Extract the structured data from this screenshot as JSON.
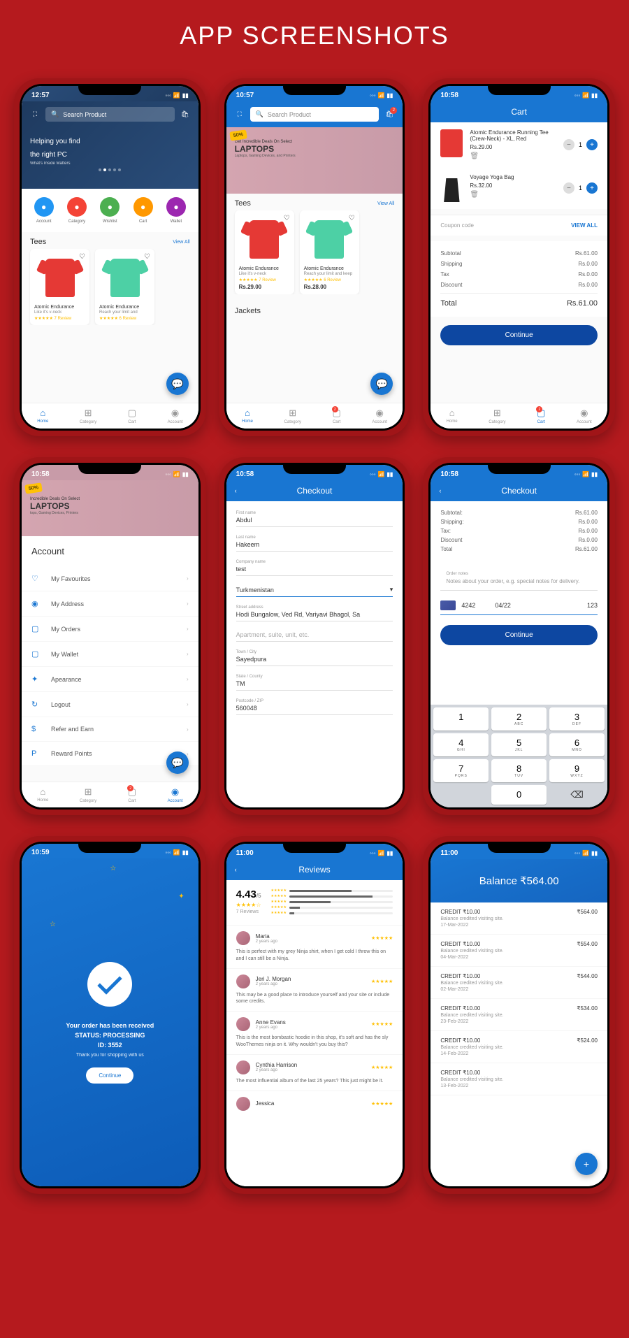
{
  "title": "APP SCREENSHOTS",
  "s1": {
    "time": "12:57",
    "search": "Search Product",
    "banner1": "Helping you find",
    "banner2": "the right PC",
    "banner3": "What's Inside Matters",
    "quick": [
      {
        "l": "Account",
        "c": "#2196f3"
      },
      {
        "l": "Category",
        "c": "#f44336"
      },
      {
        "l": "Wishlist",
        "c": "#4caf50"
      },
      {
        "l": "Cart",
        "c": "#ff9800"
      },
      {
        "l": "Wallet",
        "c": "#9c27b0"
      }
    ],
    "sect": "Tees",
    "viewall": "View All",
    "p": [
      {
        "n": "Atomic Endurance",
        "s": "Like it's v-neck",
        "r": "★★★★★ 7 Review"
      },
      {
        "n": "Atomic Endurance",
        "s": "Reach your limit and",
        "r": "★★★★★ 6 Review"
      }
    ]
  },
  "s2": {
    "time": "10:57",
    "search": "Search Product",
    "badge": "2",
    "bannerBadge": "50%",
    "bb1": "Get Incredible Deals On Select",
    "bb2": "LAPTOPS",
    "bb3": "Laptops, Gaming Devices, and Printers",
    "sect": "Tees",
    "viewall": "View All",
    "sect2": "Jackets",
    "p": [
      {
        "n": "Atomic Endurance",
        "s": "Like it's v-neck",
        "r": "★★★★★ 7 Review",
        "pr": "Rs.29.00"
      },
      {
        "n": "Atomic Endurance",
        "s": "Reach your limit and keep",
        "r": "★★★★★ 6 Review",
        "pr": "Rs.28.00"
      }
    ]
  },
  "s3": {
    "time": "10:58",
    "title": "Cart",
    "items": [
      {
        "n": "Atomic Endurance Running Tee (Crew-Neck) - XL, Red",
        "p": "Rs.29.00",
        "q": "1"
      },
      {
        "n": "Voyage Yoga Bag",
        "p": "Rs.32.00",
        "q": "1"
      }
    ],
    "coupon": "Coupon code",
    "viewall": "VIEW ALL",
    "rows": [
      [
        "Subtotal",
        "Rs.61.00"
      ],
      [
        "Shipping",
        "Rs.0.00"
      ],
      [
        "Tax",
        "Rs.0.00"
      ],
      [
        "Discount",
        "Rs.0.00"
      ]
    ],
    "total": [
      "Total",
      "Rs.61.00"
    ],
    "btn": "Continue",
    "badge": "2"
  },
  "s4": {
    "time": "10:58",
    "bannerBadge": "50%",
    "bb1": "Incredible Deals On Select",
    "bb2": "LAPTOPS",
    "bb3": "tops, Gaming Devices, Printers",
    "h": "Account",
    "badge": "2",
    "items": [
      {
        "i": "♡",
        "l": "My Favourites"
      },
      {
        "i": "◉",
        "l": "My Address"
      },
      {
        "i": "▢",
        "l": "My Orders"
      },
      {
        "i": "▢",
        "l": "My Wallet"
      },
      {
        "i": "✦",
        "l": "Apearance"
      },
      {
        "i": "↻",
        "l": "Logout"
      },
      {
        "i": "$",
        "l": "Refer and Earn"
      },
      {
        "i": "P",
        "l": "Reward Points"
      }
    ]
  },
  "s5": {
    "time": "10:58",
    "title": "Checkout",
    "f": [
      {
        "l": "First name",
        "v": "Abdul"
      },
      {
        "l": "Last name",
        "v": "Hakeem"
      },
      {
        "l": "Company name",
        "v": "test"
      },
      {
        "l": "",
        "v": "Turkmenistan",
        "sel": true
      },
      {
        "l": "Street address",
        "v": "Hodi Bungalow, Ved Rd, Variyavi Bhagol, Sa"
      },
      {
        "l": "",
        "v": "Apartment, suite, unit, etc.",
        "ph": true
      },
      {
        "l": "Town / City",
        "v": "Sayedpura"
      },
      {
        "l": "State / County",
        "v": "TM"
      },
      {
        "l": "Postcode / ZIP",
        "v": "560048"
      }
    ]
  },
  "s6": {
    "time": "10:58",
    "title": "Checkout",
    "oh": "Order",
    "rows": [
      [
        "Subtotal:",
        "Rs.61.00"
      ],
      [
        "Shipping:",
        "Rs.0.00"
      ],
      [
        "Tax:",
        "Rs.0.00"
      ],
      [
        "Discount",
        "Rs.0.00"
      ],
      [
        "Total",
        "Rs.61.00"
      ]
    ],
    "noteL": "Order notes",
    "noteT": "Notes about your order, e.g. special notes for delivery.",
    "card": [
      "4242",
      "04/22",
      "123"
    ],
    "btn": "Continue",
    "keys": [
      [
        "1",
        ""
      ],
      [
        "2",
        "ABC"
      ],
      [
        "3",
        "DEF"
      ],
      [
        "4",
        "GHI"
      ],
      [
        "5",
        "JKL"
      ],
      [
        "6",
        "MNO"
      ],
      [
        "7",
        "PQRS"
      ],
      [
        "8",
        "TUV"
      ],
      [
        "9",
        "WXYZ"
      ],
      [
        "",
        ""
      ],
      [
        "0",
        ""
      ],
      [
        "⌫",
        ""
      ]
    ]
  },
  "s7": {
    "time": "10:59",
    "l1": "Your order has been received",
    "l2": "STATUS: PROCESSING",
    "l3": "ID: 3552",
    "l4": "Thank you for shopping with us",
    "btn": "Continue"
  },
  "s8": {
    "time": "11:00",
    "title": "Reviews",
    "score": "4.43",
    "outof": "/5",
    "cnt": "7 Reviews",
    "bars": [
      60,
      80,
      40,
      10,
      5
    ],
    "r": [
      {
        "n": "Maria",
        "d": "2 years ago",
        "t": "This is perfect with my grey Ninja shirt, when I get cold I throw this on and I can still be a Ninja."
      },
      {
        "n": "Jeri J. Morgan",
        "d": "2 years ago",
        "t": "This may be a good place to introduce yourself and your site or include some credits."
      },
      {
        "n": "Anne Evans",
        "d": "2 years ago",
        "t": "This is the most bombastic hoodie in this shop, it's soft and has the sly WooThemes ninja on it. Why wouldn't you buy this?"
      },
      {
        "n": "Cynthia Harrison",
        "d": "2 years ago",
        "t": "The most influential album of the last 25 years? This just might be it."
      },
      {
        "n": "Jessica",
        "d": "",
        "t": ""
      }
    ]
  },
  "s9": {
    "time": "11:00",
    "bal": "Balance ₹564.00",
    "w": [
      {
        "a": "CREDIT  ₹10.00",
        "d": "Balance credited visiting site.",
        "dt": "17-Mar-2022",
        "b": "₹564.00"
      },
      {
        "a": "CREDIT  ₹10.00",
        "d": "Balance credited visiting site.",
        "dt": "04-Mar-2022",
        "b": "₹554.00"
      },
      {
        "a": "CREDIT  ₹10.00",
        "d": "Balance credited visiting site.",
        "dt": "02-Mar-2022",
        "b": "₹544.00"
      },
      {
        "a": "CREDIT  ₹10.00",
        "d": "Balance credited visiting site.",
        "dt": "23-Feb-2022",
        "b": "₹534.00"
      },
      {
        "a": "CREDIT  ₹10.00",
        "d": "Balance credited visiting site.",
        "dt": "14-Feb-2022",
        "b": "₹524.00"
      },
      {
        "a": "CREDIT  ₹10.00",
        "d": "Balance credited visiting site.",
        "dt": "13-Feb-2022",
        "b": ""
      }
    ]
  },
  "nav": [
    {
      "l": "Home",
      "i": "⌂"
    },
    {
      "l": "Category",
      "i": "⊞"
    },
    {
      "l": "Cart",
      "i": "▢"
    },
    {
      "l": "Account",
      "i": "◉"
    }
  ]
}
